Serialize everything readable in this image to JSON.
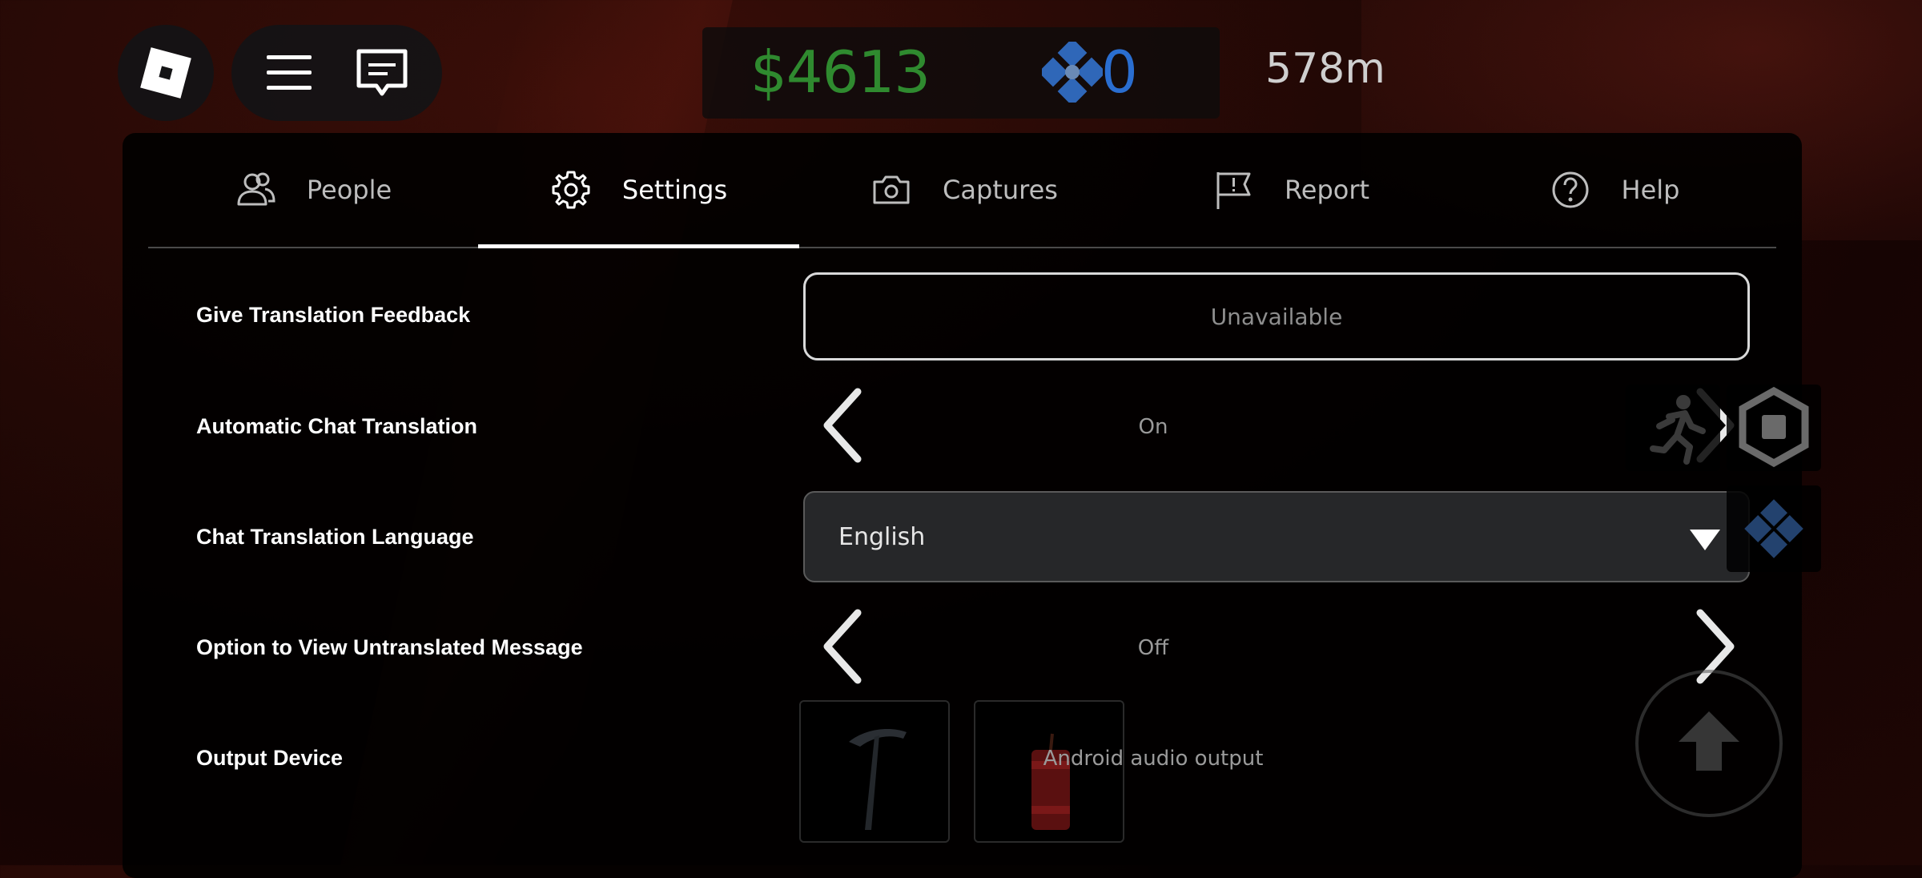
{
  "hud": {
    "money": "$4613",
    "gems": "0",
    "depth": "578m"
  },
  "tabs": [
    {
      "label": "People",
      "icon": "people-icon"
    },
    {
      "label": "Settings",
      "icon": "gear-icon",
      "active": true
    },
    {
      "label": "Captures",
      "icon": "camera-icon"
    },
    {
      "label": "Report",
      "icon": "flag-icon"
    },
    {
      "label": "Help",
      "icon": "help-icon"
    }
  ],
  "settings": {
    "translation_feedback": {
      "label": "Give Translation Feedback",
      "value": "Unavailable"
    },
    "auto_chat_translation": {
      "label": "Automatic Chat Translation",
      "value": "On"
    },
    "chat_translation_language": {
      "label": "Chat Translation Language",
      "value": "English"
    },
    "view_untranslated": {
      "label": "Option to View Untranslated Message",
      "value": "Off"
    },
    "output_device": {
      "label": "Output Device",
      "value": "Android audio output"
    }
  },
  "colors": {
    "money": "#2f8a2f",
    "gems": "#2a6ed0",
    "panel": "#000000",
    "accent_active_tab": "#ffffff"
  }
}
